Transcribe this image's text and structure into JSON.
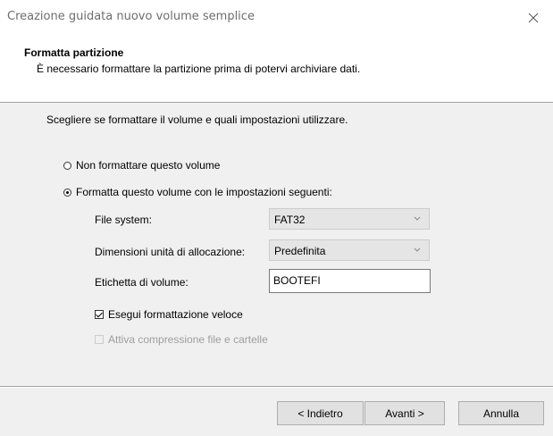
{
  "window": {
    "title": "Creazione guidata nuovo volume semplice",
    "close_icon": "close-icon"
  },
  "header": {
    "title": "Formatta partizione",
    "subtitle": "È necessario formattare la partizione prima di potervi archiviare dati."
  },
  "main": {
    "intro": "Scegliere se formattare il volume e quali impostazioni utilizzare.",
    "options": [
      {
        "label": "Non formattare questo volume",
        "selected": false
      },
      {
        "label": "Formatta questo volume con le impostazioni seguenti:",
        "selected": true
      }
    ],
    "fields": {
      "file_system": {
        "label": "File system:",
        "value": "FAT32"
      },
      "allocation": {
        "label": "Dimensioni unità di allocazione:",
        "value": "Predefinita"
      },
      "volume_label": {
        "label": "Etichetta di volume:",
        "value": "BOOTEFI"
      }
    },
    "checkboxes": [
      {
        "label": "Esegui formattazione veloce",
        "checked": true,
        "enabled": true
      },
      {
        "label": "Attiva compressione file e cartelle",
        "checked": false,
        "enabled": false
      }
    ]
  },
  "footer": {
    "back": "< Indietro",
    "next": "Avanti >",
    "cancel": "Annulla"
  }
}
